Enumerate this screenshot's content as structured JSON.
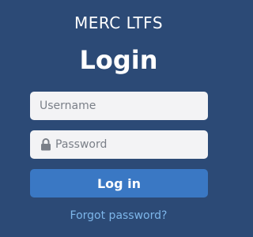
{
  "header": {
    "app_name": "MERC LTFS",
    "heading": "Login"
  },
  "form": {
    "username": {
      "value": "",
      "placeholder": "Username"
    },
    "password": {
      "value": "",
      "placeholder": "Password",
      "icon": "lock-icon"
    },
    "login_button_label": "Log in",
    "forgot_password_label": "Forgot password?"
  },
  "colors": {
    "background": "#2c4a76",
    "input_background": "#f3f3f5",
    "button": "#3a78c4",
    "link": "#7db6ea",
    "text": "#ffffff"
  }
}
